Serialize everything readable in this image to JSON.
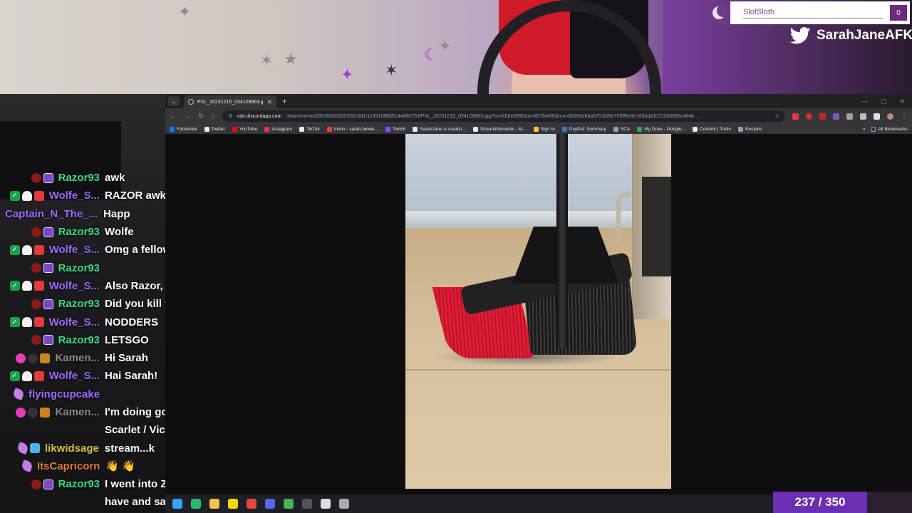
{
  "overlay": {
    "user_widget": {
      "name": "SlofSloth",
      "count": "0"
    },
    "twitter_handle": "SarahJaneAFK",
    "goal_counter": "237 / 350"
  },
  "browser": {
    "tab_title": "PXL_20231215_034128863.jpg",
    "url_host": "cdn.discordapp.com",
    "url_path": "/attachments/935363003325501581/1185108809144860753/PXL_20231215_034128863.jpg?ex=658e6996&is=657bf496&hm=8b950e8ab0701fd9e75f3f6e9e7d5bda3072350686c464b...",
    "bookmarks": [
      {
        "label": "Facebook",
        "color": "#1877f2"
      },
      {
        "label": "Twitter",
        "color": "#e8eaed"
      },
      {
        "label": "YouTube",
        "color": "#ff0000"
      },
      {
        "label": "Instagram",
        "color": "#e1306c"
      },
      {
        "label": "TikTok",
        "color": "#e8eaed"
      },
      {
        "label": "Inbox - sarah.bewle...",
        "color": "#ea4335"
      },
      {
        "label": "Twitch",
        "color": "#9146ff"
      },
      {
        "label": "SarahJane is creatin...",
        "color": "#e8eaed"
      },
      {
        "label": "StreamElements - M...",
        "color": "#e8eaed"
      },
      {
        "label": "Sign In",
        "color": "#f2c94c"
      },
      {
        "label": "PayPal: Summary",
        "color": "#3b7bbf"
      },
      {
        "label": "SCA",
        "color": "#9aa0a6"
      },
      {
        "label": "My Drive - Google...",
        "color": "#34a853"
      },
      {
        "label": "Content | Trello",
        "color": "#e8eaed"
      },
      {
        "label": "Recipes",
        "color": "#9aa0a6"
      }
    ],
    "all_bookmarks": "All Bookmarks"
  },
  "chat": [
    {
      "user": "Razor93",
      "color": "#3ddc84",
      "badges": [
        "b-red",
        "b-sub"
      ],
      "msg": "awk"
    },
    {
      "user": "Wolfe_S...",
      "color": "#9b6bff",
      "badges": [
        "b-mod",
        "b-ghost",
        "b-gift"
      ],
      "msg": "RAZOR awk"
    },
    {
      "user": "Captain_N_The_...",
      "color": "#9b6bff",
      "badges": [],
      "msg": "Happ"
    },
    {
      "user": "Razor93",
      "color": "#3ddc84",
      "badges": [
        "b-red",
        "b-sub"
      ],
      "msg": "Wolfe"
    },
    {
      "user": "Wolfe_S...",
      "color": "#9b6bff",
      "badges": [
        "b-mod",
        "b-ghost",
        "b-gift"
      ],
      "msg": "Omg a fellow"
    },
    {
      "user": "Razor93",
      "color": "#3ddc84",
      "badges": [
        "b-red",
        "b-sub"
      ],
      "msg": ""
    },
    {
      "user": "Wolfe_S...",
      "color": "#9b6bff",
      "badges": [
        "b-mod",
        "b-ghost",
        "b-gift"
      ],
      "msg": "Also Razor,"
    },
    {
      "user": "Razor93",
      "color": "#3ddc84",
      "badges": [
        "b-red",
        "b-sub"
      ],
      "msg": "Did you kill t"
    },
    {
      "user": "Wolfe_S...",
      "color": "#9b6bff",
      "badges": [
        "b-mod",
        "b-ghost",
        "b-gift"
      ],
      "msg": "NODDERS"
    },
    {
      "user": "Razor93",
      "color": "#3ddc84",
      "badges": [
        "b-red",
        "b-sub"
      ],
      "msg": "LETSGO"
    },
    {
      "user": "Kamen...",
      "color": "#8a8a8a",
      "badges": [
        "b-heart",
        "b-cat",
        "b-year"
      ],
      "msg": "Hi Sarah"
    },
    {
      "user": "Wolfe_S...",
      "color": "#9b6bff",
      "badges": [
        "b-mod",
        "b-ghost",
        "b-gift"
      ],
      "msg": "Hai Sarah!"
    },
    {
      "user": "flyingcupcake",
      "color": "#9b6bff",
      "badges": [
        "b-gem"
      ],
      "msg": ""
    },
    {
      "user": "Kamen...",
      "color": "#8a8a8a",
      "badges": [
        "b-heart",
        "b-cat",
        "b-year"
      ],
      "msg": "I'm doing go"
    },
    {
      "user": "",
      "color": "#ffffff",
      "badges": [],
      "msg": "Scarlet / Vic"
    },
    {
      "user": "likwidsage",
      "color": "#d4c33a",
      "badges": [
        "b-gem",
        "b-crown"
      ],
      "msg": "stream...k"
    },
    {
      "user": "ItsCapricorn",
      "color": "#e0783a",
      "badges": [
        "b-gem"
      ],
      "msg": "👋 👋"
    },
    {
      "user": "Razor93",
      "color": "#3ddc84",
      "badges": [
        "b-red",
        "b-sub"
      ],
      "msg": "I went into Z"
    },
    {
      "user": "",
      "color": "#ffffff",
      "badges": [],
      "msg": "have and sa"
    }
  ],
  "taskbar": {
    "icons": [
      {
        "name": "windows-start-icon",
        "color": "#3aa0ff"
      },
      {
        "name": "edge-icon",
        "color": "#2bb673"
      },
      {
        "name": "file-explorer-icon",
        "color": "#f2c14e"
      },
      {
        "name": "sticky-notes-icon",
        "color": "#f5d90a"
      },
      {
        "name": "chrome-icon",
        "color": "#e8453c"
      },
      {
        "name": "discord-icon",
        "color": "#5865f2"
      },
      {
        "name": "chrome-profile-icon",
        "color": "#4caf50"
      },
      {
        "name": "obs-icon",
        "color": "#555555"
      },
      {
        "name": "app-icon",
        "color": "#dddddd"
      },
      {
        "name": "streamer-bot-icon",
        "color": "#aaaaaa"
      }
    ]
  }
}
